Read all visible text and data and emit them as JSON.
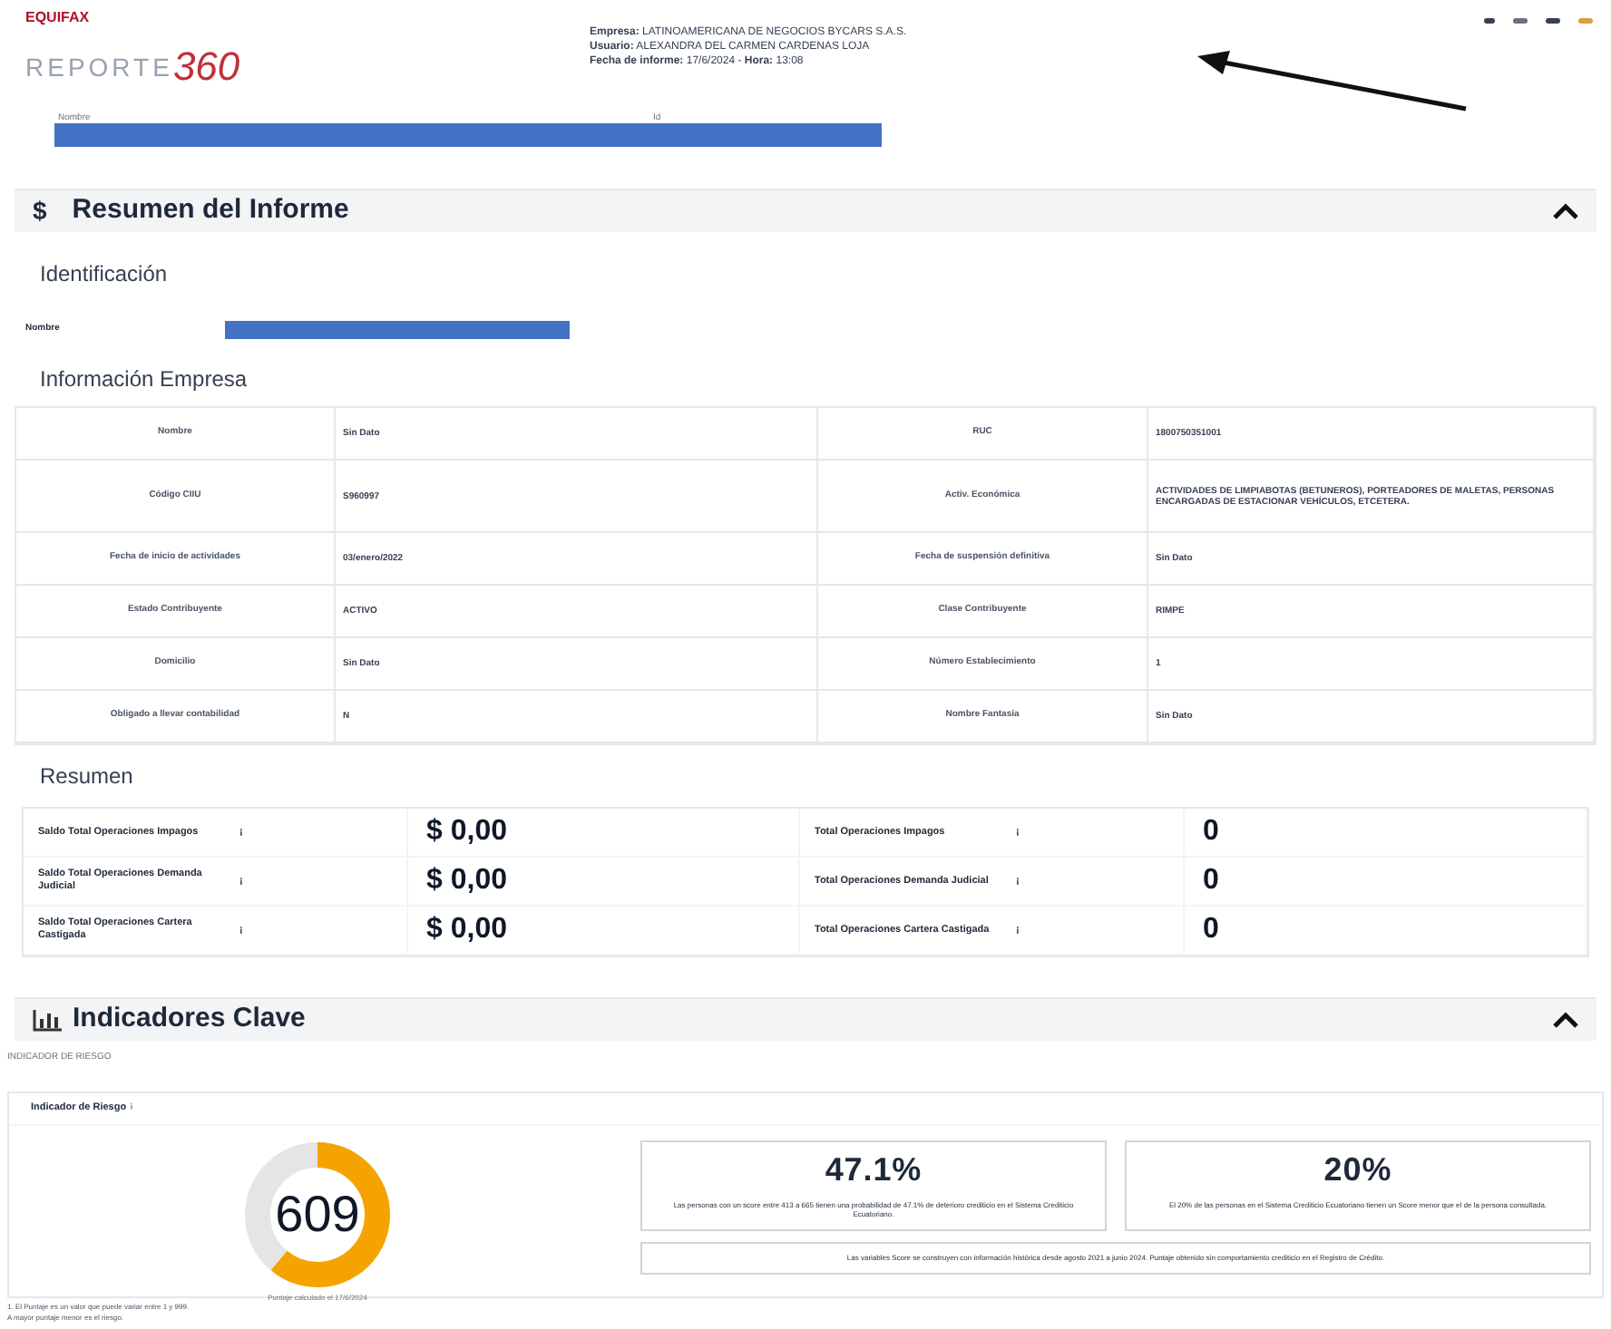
{
  "header": {
    "brand": "EQUIFAX",
    "logo_text": "REPORTE",
    "logo_number": "360",
    "info": [
      "**Empresa:** LATINOAMERICANA DE NEGOCIOS BYCARS S.A.S.",
      "**Usuario:** ALEXANDRA DEL CARMEN CARDENAS LOJA",
      "**Fecha de informe:** 17/6/2024 - **Hora:** 13:08"
    ],
    "redacted_labels": [
      "Nombre",
      "Id"
    ]
  },
  "summary_section": {
    "icon": "$",
    "title": "Resumen del Informe",
    "expanded": true
  },
  "identification": {
    "title": "Identificación",
    "label": "Nombre"
  },
  "company": {
    "title": "Información Empresa",
    "rows": [
      [
        "Nombre",
        "Sin Dato",
        "RUC",
        "1800750351001"
      ],
      [
        "Código CIIU",
        "S960997",
        "Activ. Económica",
        "ACTIVIDADES DE LIMPIABOTAS (BETUNEROS), PORTEADORES DE MALETAS, PERSONAS ENCARGADAS DE ESTACIONAR VEHÍCULOS, ETCETERA."
      ],
      [
        "Fecha de inicio de actividades",
        "03/enero/2022",
        "Fecha de suspensión definitiva",
        "Sin Dato"
      ],
      [
        "Estado Contribuyente",
        "ACTIVO",
        "Clase Contribuyente",
        "RIMPE"
      ],
      [
        "Domicilio",
        "Sin Dato",
        "Número Establecimiento",
        "1"
      ],
      [
        "Obligado a llevar contabilidad",
        "N",
        "Nombre Fantasía",
        "Sin Dato"
      ]
    ]
  },
  "resumen": {
    "title": "Resumen",
    "rows": [
      [
        "Saldo Total Operaciones Impagos",
        "$ 0,00",
        "Total Operaciones Impagos",
        "0"
      ],
      [
        "Saldo Total Operaciones Demanda Judicial",
        "$ 0,00",
        "Total Operaciones Demanda Judicial",
        "0"
      ],
      [
        "Saldo Total Operaciones Cartera Castigada",
        "$ 0,00",
        "Total Operaciones Cartera Castigada",
        "0"
      ]
    ],
    "info_mark": "¡"
  },
  "indicators": {
    "title": "Indicadores Clave",
    "expanded": true,
    "subtitle": "INDICADOR DE RIESGO",
    "card_title": "Indicador de Riesgo",
    "score": "609",
    "level": 0.61,
    "score_caption": "Puntaje calculado el 17/6/2024",
    "stats": [
      {
        "value": "47.1%",
        "text": "Las personas con un score entre 413 a 665 tienen una probabilidad de 47.1% de deterioro crediticio en el Sistema Crediticio Ecuatoriano."
      },
      {
        "value": "20%",
        "text": "El 20% de las personas en el Sistema Crediticio Ecuatoriano tienen un Score menor que el de la persona consultada."
      }
    ],
    "note": "Las variables Score se construyen con información histórica desde agosto 2021 a junio 2024. Puntaje obtenido sin comportamiento crediticio en el Registro de Crédito.",
    "footnotes": [
      "1. El Puntaje es un valor que puede variar entre 1 y 999.",
      "A mayor puntaje menor es el riesgo."
    ]
  }
}
